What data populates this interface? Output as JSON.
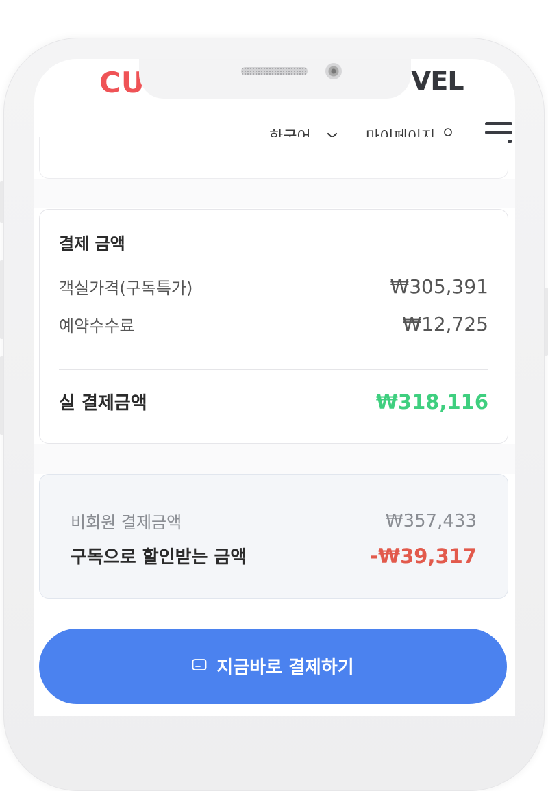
{
  "header": {
    "logo_left": "CUC",
    "logo_right": "VEL",
    "language": "한국어",
    "mypage": "마이페이지"
  },
  "payment": {
    "title": "결제 금액",
    "rows": [
      {
        "label": "객실가격(구독특가)",
        "value": "₩305,391"
      },
      {
        "label": "예약수수료",
        "value": "₩12,725"
      }
    ],
    "total_label": "실 결제금액",
    "total_value": "₩318,116"
  },
  "discount": {
    "nonmember_label": "비회원 결제금액",
    "nonmember_value": "₩357,433",
    "saving_label": "구독으로 할인받는 금액",
    "saving_value": "-₩39,317"
  },
  "pay_button": {
    "label": "지금바로 결제하기"
  },
  "colors": {
    "logo_red": "#ef5356",
    "total_green": "#3fcf7f",
    "saving_red": "#e25a4c",
    "button_blue": "#4b82ef"
  }
}
